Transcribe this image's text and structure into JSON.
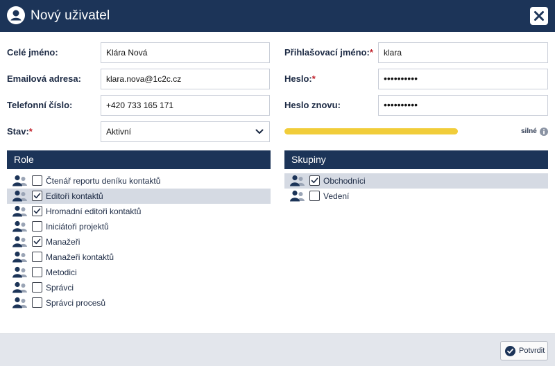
{
  "dialog": {
    "title": "Nový uživatel",
    "close_icon": "close-icon",
    "header_icon": "user-icon"
  },
  "form": {
    "full_name": {
      "label": "Celé jméno:",
      "value": "Klára Nová"
    },
    "email": {
      "label": "Emailová adresa:",
      "value": "klara.nova@1c2c.cz"
    },
    "phone": {
      "label": "Telefonní číslo:",
      "value": "+420 733 165 171"
    },
    "status": {
      "label": "Stav:",
      "required_mark": "*",
      "value": "Aktivní"
    },
    "login": {
      "label": "Přihlašovací jméno:",
      "required_mark": "*",
      "value": "klara"
    },
    "password": {
      "label": "Heslo:",
      "required_mark": "*",
      "value": "••••••••••"
    },
    "password_again": {
      "label": "Heslo znovu:",
      "value": "••••••••••"
    },
    "strength": {
      "text": "silné",
      "level": 0.85,
      "color": "#f1cd3a"
    }
  },
  "roles": {
    "title": "Role",
    "items": [
      {
        "label": "Čtenář reportu deníku kontaktů",
        "checked": false,
        "highlighted": false
      },
      {
        "label": "Editoři kontaktů",
        "checked": true,
        "highlighted": true
      },
      {
        "label": "Hromadní editoři kontaktů",
        "checked": true,
        "highlighted": false
      },
      {
        "label": "Iniciátoři projektů",
        "checked": false,
        "highlighted": false
      },
      {
        "label": "Manažeři",
        "checked": true,
        "highlighted": false
      },
      {
        "label": "Manažeři kontaktů",
        "checked": false,
        "highlighted": false
      },
      {
        "label": "Metodici",
        "checked": false,
        "highlighted": false
      },
      {
        "label": "Správci",
        "checked": false,
        "highlighted": false
      },
      {
        "label": "Správci procesů",
        "checked": false,
        "highlighted": false
      }
    ]
  },
  "groups": {
    "title": "Skupiny",
    "items": [
      {
        "label": "Obchodníci",
        "checked": true,
        "highlighted": true
      },
      {
        "label": "Vedení",
        "checked": false,
        "highlighted": false
      }
    ]
  },
  "footer": {
    "confirm_label": "Potvrdit",
    "confirm_icon": "check-circle-icon"
  },
  "colors": {
    "header": "#1c3458",
    "accent_required": "#c0202a",
    "row_highlight": "#d5dae3"
  }
}
